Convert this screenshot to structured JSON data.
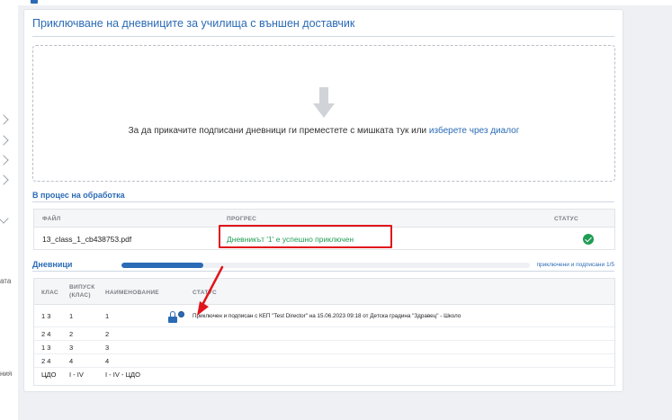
{
  "sidebar": {
    "fragments": [
      "ата",
      "ния"
    ]
  },
  "card": {
    "title": "Приключване на дневниците за училища с външен доставчик"
  },
  "dropzone": {
    "text": "За да прикачите подписани дневници ги преместете с мишката тук или",
    "link": "изберете чрез диалог"
  },
  "processing": {
    "section_title": "В процес на обработка",
    "columns": {
      "file": "ФАЙЛ",
      "progress": "ПРОГРЕС",
      "status": "СТАТУС"
    },
    "row": {
      "file": "13_class_1_cb438753.pdf",
      "progress_text": "Дневникът '1' е успешно приключен",
      "status_icon": "check-circle-icon"
    }
  },
  "diaries": {
    "section_title": "Дневници",
    "progress_fraction": 0.2,
    "progress_label": "приключени и подписани 1/5",
    "columns": {
      "class": "КЛАС",
      "issue_line1": "ВИПУСК",
      "issue_line2": "(КЛАС)",
      "name": "НАИМЕНОВАНИЕ",
      "status": "СТАТУС"
    },
    "rows": [
      {
        "class": "1 3",
        "issue": "1",
        "name": "1",
        "status": "Приключен и подписан с КЕП \"Test Director\" на 15.06.2023 09:18 от Детска градина \"Здравец\" - Школо"
      },
      {
        "class": "2 4",
        "issue": "2",
        "name": "2",
        "status": ""
      },
      {
        "class": "1 3",
        "issue": "3",
        "name": "3",
        "status": ""
      },
      {
        "class": "2 4",
        "issue": "4",
        "name": "4",
        "status": ""
      },
      {
        "class": "ЦДО",
        "issue": "I - IV",
        "name": "I - IV - ЦДО",
        "status": ""
      }
    ]
  },
  "colors": {
    "accent": "#2b6bb5",
    "success": "#1f9d55",
    "annotation": "#e0161b"
  }
}
